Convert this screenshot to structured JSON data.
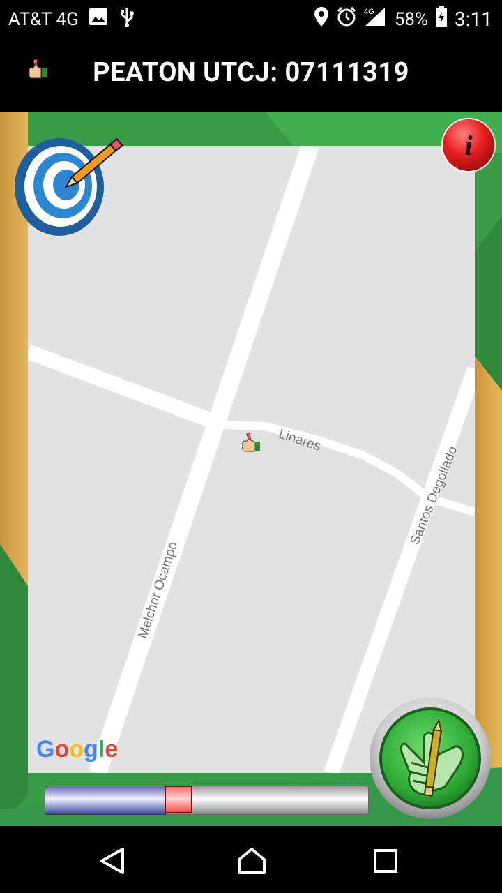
{
  "status_bar": {
    "carrier": "AT&T 4G",
    "network": "4G",
    "battery": "58%",
    "time": "3:11",
    "icons": [
      "image-icon",
      "usb-icon",
      "location-icon",
      "alarm-icon",
      "signal-icon",
      "battery-icon"
    ]
  },
  "app_bar": {
    "title": "PEATON UTCJ: 07111319",
    "icon": "thumbs-up-hand-icon"
  },
  "map": {
    "streets": [
      "Linares",
      "Santos Degollado",
      "Melchor Ocampo"
    ],
    "attribution": "Google",
    "marker": "thumbs-up-hand-icon"
  },
  "controls": {
    "target_icon": "target-pencil-icon",
    "info_label": "i",
    "action_icon": "thumb-pencil-icon",
    "slider_value": 0.37
  },
  "nav_bar": {
    "icons": [
      "back-icon",
      "home-icon",
      "recents-icon"
    ]
  },
  "colors": {
    "green": "#3a9b47",
    "tan": "#d9a94c",
    "map_bg": "#e2e2e2",
    "info_red": "#e0201f",
    "slider_blue": "#3c4a9e"
  }
}
